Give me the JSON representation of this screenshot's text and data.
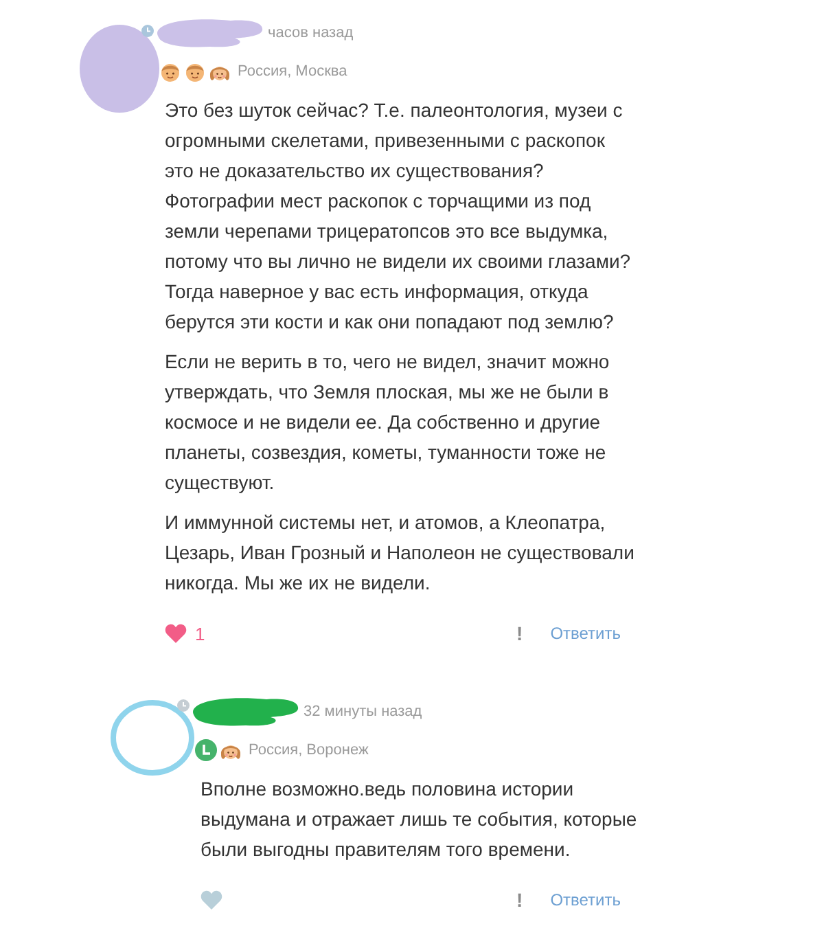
{
  "comments": [
    {
      "avatar": {
        "kind": "filled",
        "color": "#c9bfe7"
      },
      "redaction": {
        "color": "#cbc1e8"
      },
      "time": "часов назад",
      "badges": [
        {
          "kind": "boy"
        },
        {
          "kind": "boy"
        },
        {
          "kind": "girl"
        }
      ],
      "location": "Россия, Москва",
      "paragraphs": [
        "Это без шуток сейчас? Т.е. палеонтология, музеи с огромными скелетами, привезенными с раскопок это не доказательство их существования? Фотографии мест раскопок с торчащими из под земли черепами трицератопсов это все выдумка, потому что вы лично не видели их своими глазами? Тогда наверное у вас есть информация, откуда берутся эти кости и как они попадают под землю?",
        "Если не верить в то, чего не видел, значит можно утверждать, что Земля плоская, мы же не были в космосе и не видели ее. Да собственно и другие планеты, созвездия, кометы, туманности тоже не существуют.",
        "И иммунной системы нет, и атомов, а Клеопатра, Цезарь, Иван Грозный и Наполеон не существовали никогда. Мы же их не видели."
      ],
      "likes": {
        "liked": true,
        "count": "1"
      },
      "report": "!",
      "reply": "Ответить",
      "children": [
        {
          "avatar": {
            "kind": "ring",
            "color": "#8fd4ec"
          },
          "redaction": {
            "color": "#22b14c"
          },
          "time": "32 минуты назад",
          "badges": [
            {
              "kind": "clock"
            },
            {
              "kind": "girl"
            }
          ],
          "location": "Россия, Воронеж",
          "paragraphs": [
            "Вполне возможно.ведь половина истории выдумана и отражает лишь те события, которые были выгодны правителям того времени."
          ],
          "likes": {
            "liked": false
          },
          "report": "!",
          "reply": "Ответить"
        }
      ]
    }
  ]
}
